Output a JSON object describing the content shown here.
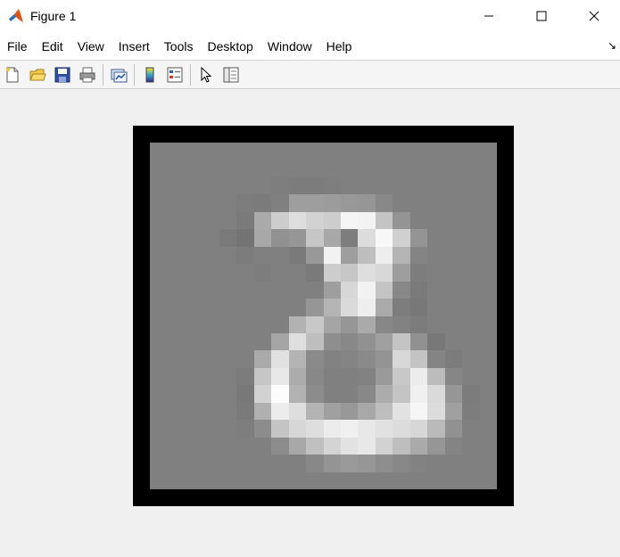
{
  "window": {
    "title": "Figure 1",
    "controls": {
      "minimize": "—",
      "maximize": "☐",
      "close": "✕"
    }
  },
  "menu": {
    "items": [
      "File",
      "Edit",
      "View",
      "Insert",
      "Tools",
      "Desktop",
      "Window",
      "Help"
    ],
    "dock_arrow": "↘"
  },
  "toolbar": {
    "buttons": [
      {
        "name": "new-figure-icon",
        "group": 1
      },
      {
        "name": "open-file-icon",
        "group": 1
      },
      {
        "name": "save-icon",
        "group": 1
      },
      {
        "name": "print-icon",
        "group": 1
      },
      {
        "name": "link-plot-icon",
        "group": 2
      },
      {
        "name": "insert-colorbar-icon",
        "group": 3
      },
      {
        "name": "insert-legend-icon",
        "group": 3
      },
      {
        "name": "edit-plot-arrow-icon",
        "group": 4
      },
      {
        "name": "property-inspector-icon",
        "group": 4
      }
    ]
  },
  "image": {
    "rows": 20,
    "cols": 20,
    "colormap": "gray",
    "background_value": 128,
    "pixels": [
      [
        128,
        128,
        128,
        128,
        128,
        128,
        128,
        128,
        128,
        128,
        128,
        128,
        128,
        128,
        128,
        128,
        128,
        128,
        128,
        128
      ],
      [
        128,
        128,
        128,
        128,
        128,
        128,
        128,
        128,
        128,
        128,
        128,
        128,
        128,
        128,
        128,
        128,
        128,
        128,
        128,
        128
      ],
      [
        128,
        128,
        128,
        128,
        128,
        128,
        128,
        126,
        124,
        124,
        126,
        128,
        128,
        128,
        128,
        128,
        128,
        128,
        128,
        128
      ],
      [
        128,
        128,
        128,
        128,
        128,
        125,
        123,
        128,
        158,
        158,
        156,
        152,
        150,
        136,
        128,
        128,
        128,
        128,
        128,
        128
      ],
      [
        128,
        128,
        128,
        128,
        128,
        122,
        170,
        205,
        222,
        210,
        205,
        245,
        242,
        196,
        148,
        128,
        128,
        128,
        128,
        128
      ],
      [
        128,
        128,
        128,
        128,
        122,
        116,
        168,
        145,
        150,
        198,
        168,
        125,
        220,
        248,
        208,
        148,
        128,
        128,
        128,
        128
      ],
      [
        128,
        128,
        128,
        128,
        128,
        124,
        128,
        128,
        122,
        152,
        242,
        158,
        190,
        238,
        180,
        132,
        128,
        128,
        128,
        128
      ],
      [
        128,
        128,
        128,
        128,
        128,
        128,
        125,
        128,
        128,
        122,
        205,
        198,
        222,
        216,
        158,
        125,
        128,
        128,
        128,
        128
      ],
      [
        128,
        128,
        128,
        128,
        128,
        128,
        128,
        128,
        128,
        128,
        158,
        215,
        242,
        196,
        136,
        122,
        128,
        128,
        128,
        128
      ],
      [
        128,
        128,
        128,
        128,
        128,
        128,
        128,
        128,
        128,
        150,
        180,
        218,
        238,
        170,
        125,
        120,
        128,
        128,
        128,
        128
      ],
      [
        128,
        128,
        128,
        128,
        128,
        128,
        128,
        128,
        178,
        200,
        165,
        150,
        170,
        135,
        130,
        124,
        128,
        128,
        128,
        128
      ],
      [
        128,
        128,
        128,
        128,
        128,
        128,
        128,
        165,
        222,
        190,
        142,
        136,
        145,
        160,
        196,
        145,
        120,
        128,
        128,
        128
      ],
      [
        128,
        128,
        128,
        128,
        128,
        128,
        170,
        225,
        180,
        138,
        130,
        132,
        138,
        148,
        216,
        196,
        132,
        124,
        128,
        128
      ],
      [
        128,
        128,
        128,
        128,
        128,
        124,
        198,
        232,
        172,
        136,
        128,
        128,
        130,
        154,
        200,
        236,
        188,
        134,
        128,
        128
      ],
      [
        128,
        128,
        128,
        128,
        128,
        120,
        210,
        252,
        178,
        140,
        128,
        128,
        136,
        172,
        196,
        240,
        218,
        150,
        124,
        128
      ],
      [
        128,
        128,
        128,
        128,
        128,
        122,
        176,
        236,
        222,
        180,
        160,
        152,
        168,
        190,
        226,
        246,
        220,
        160,
        125,
        128
      ],
      [
        128,
        128,
        128,
        128,
        128,
        126,
        140,
        196,
        215,
        222,
        236,
        240,
        232,
        225,
        220,
        215,
        186,
        145,
        128,
        128
      ],
      [
        128,
        128,
        128,
        128,
        128,
        128,
        128,
        140,
        168,
        192,
        212,
        226,
        232,
        210,
        190,
        170,
        150,
        132,
        128,
        128
      ],
      [
        128,
        128,
        128,
        128,
        128,
        128,
        128,
        128,
        128,
        136,
        148,
        154,
        150,
        142,
        136,
        130,
        128,
        128,
        128,
        128
      ],
      [
        128,
        128,
        128,
        128,
        128,
        128,
        128,
        128,
        128,
        128,
        128,
        128,
        128,
        128,
        128,
        128,
        128,
        128,
        128,
        128
      ]
    ]
  }
}
